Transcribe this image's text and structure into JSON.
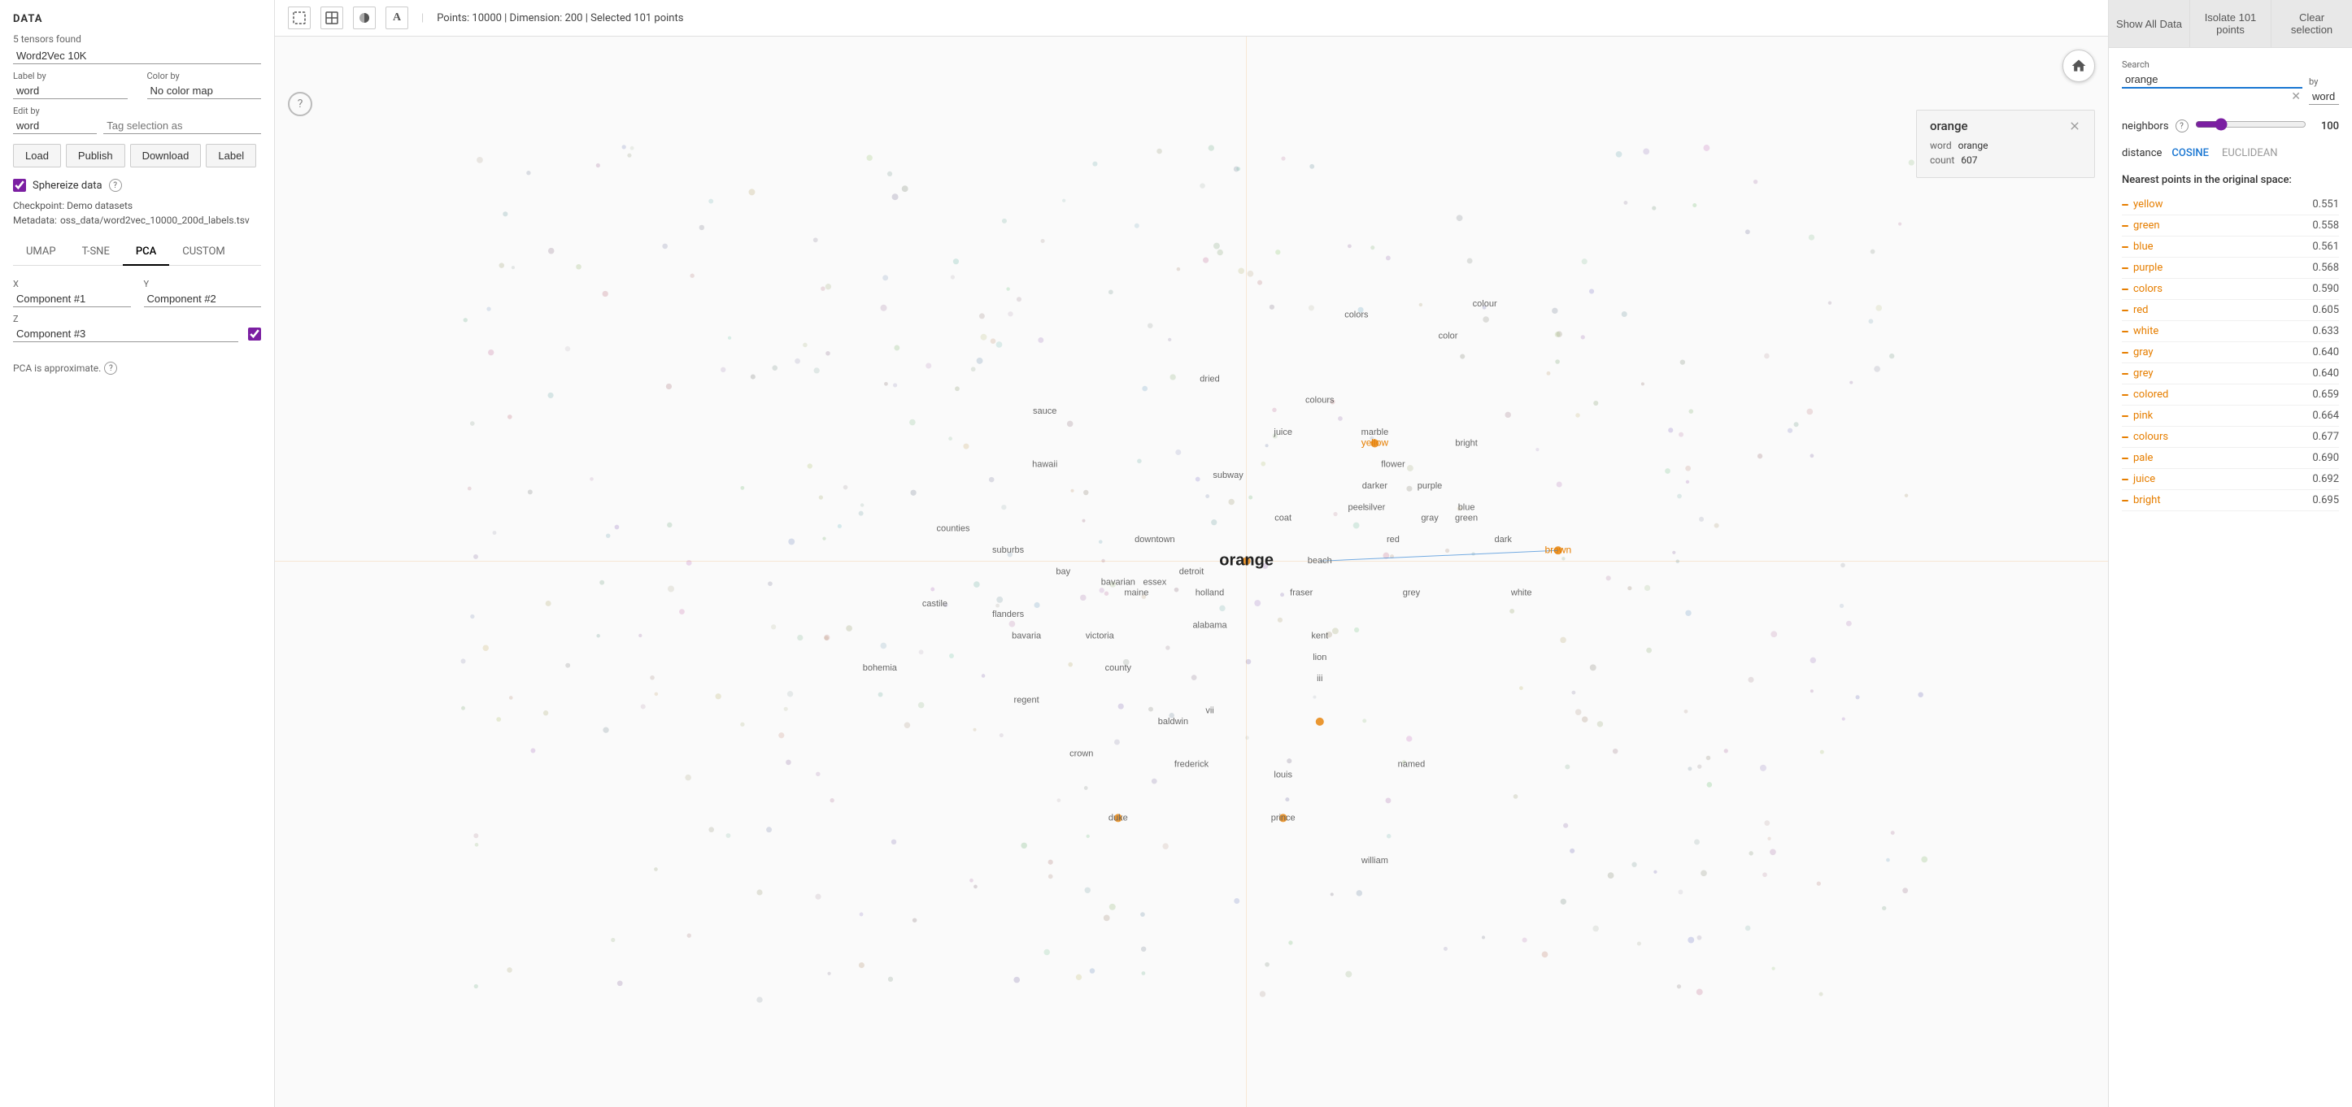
{
  "left_panel": {
    "title": "DATA",
    "tensor_count_label": "5 tensors found",
    "selected_tensor": "Word2Vec 10K",
    "label_by": {
      "label": "Label by",
      "value": "word"
    },
    "color_by": {
      "label": "Color by",
      "value": "No color map"
    },
    "edit_by": {
      "label": "Edit by",
      "value": "word"
    },
    "tag_selection_label": "Tag selection as",
    "buttons": {
      "load": "Load",
      "publish": "Publish",
      "download": "Download",
      "label": "Label"
    },
    "sphereize": {
      "label": "Sphereize data",
      "checked": true
    },
    "checkpoint": {
      "label": "Checkpoint:",
      "value": "Demo datasets"
    },
    "metadata": {
      "label": "Metadata:",
      "value": "oss_data/word2vec_10000_200d_labels.tsv"
    },
    "tabs": [
      "UMAP",
      "T-SNE",
      "PCA",
      "CUSTOM"
    ],
    "active_tab": "PCA",
    "axes": {
      "x_label": "X",
      "x_value": "Component #1",
      "y_label": "Y",
      "y_value": "Component #2",
      "z_label": "Z",
      "z_value": "Component #3",
      "z_checked": true
    },
    "pca_note": "PCA is approximate."
  },
  "toolbar": {
    "stats": "Points: 10000 | Dimension: 200 | Selected 101 points"
  },
  "right_panel": {
    "buttons": {
      "show_all": "Show All Data",
      "isolate": "Isolate 101 points",
      "clear": "Clear selection"
    },
    "search_label": "Search",
    "search_value": "orange",
    "by_label": "by",
    "by_value": "word",
    "neighbors_label": "neighbors",
    "neighbors_value": 100,
    "distance_label": "distance",
    "distance_options": [
      "COSINE",
      "EUCLIDEAN"
    ],
    "active_distance": "COSINE",
    "nearest_title": "Nearest points in the original space:",
    "nearest_items": [
      {
        "word": "yellow",
        "score": "0.551"
      },
      {
        "word": "green",
        "score": "0.558"
      },
      {
        "word": "blue",
        "score": "0.561"
      },
      {
        "word": "purple",
        "score": "0.568"
      },
      {
        "word": "colors",
        "score": "0.590"
      },
      {
        "word": "red",
        "score": "0.605"
      },
      {
        "word": "white",
        "score": "0.633"
      },
      {
        "word": "gray",
        "score": "0.640"
      },
      {
        "word": "grey",
        "score": "0.640"
      },
      {
        "word": "colored",
        "score": "0.659"
      },
      {
        "word": "pink",
        "score": "0.664"
      },
      {
        "word": "colours",
        "score": "0.677"
      },
      {
        "word": "pale",
        "score": "0.690"
      },
      {
        "word": "juice",
        "score": "0.692"
      },
      {
        "word": "bright",
        "score": "0.695"
      }
    ]
  },
  "hover_popup": {
    "word_label": "word",
    "word_value": "orange",
    "count_label": "count",
    "count_value": "607"
  },
  "scatter_words": [
    {
      "text": "colors",
      "x": 59,
      "y": 26,
      "type": "normal"
    },
    {
      "text": "colour",
      "x": 66,
      "y": 25,
      "type": "normal"
    },
    {
      "text": "color",
      "x": 64,
      "y": 28,
      "type": "normal"
    },
    {
      "text": "dried",
      "x": 51,
      "y": 32,
      "type": "normal"
    },
    {
      "text": "sauce",
      "x": 42,
      "y": 35,
      "type": "normal"
    },
    {
      "text": "juice",
      "x": 55,
      "y": 37,
      "type": "normal"
    },
    {
      "text": "marble",
      "x": 60,
      "y": 37,
      "type": "normal"
    },
    {
      "text": "colours",
      "x": 57,
      "y": 34,
      "type": "normal"
    },
    {
      "text": "yellow",
      "x": 60,
      "y": 38,
      "type": "orange"
    },
    {
      "text": "hawaii",
      "x": 42,
      "y": 40,
      "type": "normal"
    },
    {
      "text": "flower",
      "x": 61,
      "y": 40,
      "type": "normal"
    },
    {
      "text": "darker",
      "x": 60,
      "y": 42,
      "type": "normal"
    },
    {
      "text": "bright",
      "x": 65,
      "y": 38,
      "type": "normal"
    },
    {
      "text": "purple",
      "x": 63,
      "y": 42,
      "type": "normal"
    },
    {
      "text": "subway",
      "x": 52,
      "y": 41,
      "type": "normal"
    },
    {
      "text": "blue",
      "x": 65,
      "y": 44,
      "type": "normal"
    },
    {
      "text": "silver",
      "x": 60,
      "y": 44,
      "type": "normal"
    },
    {
      "text": "gray",
      "x": 63,
      "y": 45,
      "type": "normal"
    },
    {
      "text": "coat",
      "x": 55,
      "y": 45,
      "type": "normal"
    },
    {
      "text": "peel",
      "x": 59,
      "y": 44,
      "type": "normal"
    },
    {
      "text": "green",
      "x": 65,
      "y": 45,
      "type": "normal"
    },
    {
      "text": "counties",
      "x": 37,
      "y": 46,
      "type": "normal"
    },
    {
      "text": "suburbs",
      "x": 40,
      "y": 48,
      "type": "normal"
    },
    {
      "text": "downtown",
      "x": 48,
      "y": 47,
      "type": "normal"
    },
    {
      "text": "beach",
      "x": 57,
      "y": 49,
      "type": "normal"
    },
    {
      "text": "red",
      "x": 61,
      "y": 47,
      "type": "normal"
    },
    {
      "text": "dark",
      "x": 67,
      "y": 47,
      "type": "normal"
    },
    {
      "text": "orange",
      "x": 53,
      "y": 49,
      "type": "large-orange"
    },
    {
      "text": "brown",
      "x": 70,
      "y": 48,
      "type": "orange"
    },
    {
      "text": "bay",
      "x": 43,
      "y": 50,
      "type": "normal"
    },
    {
      "text": "detroit",
      "x": 50,
      "y": 50,
      "type": "normal"
    },
    {
      "text": "essex",
      "x": 48,
      "y": 51,
      "type": "normal"
    },
    {
      "text": "bavarian",
      "x": 46,
      "y": 51,
      "type": "normal"
    },
    {
      "text": "maine",
      "x": 47,
      "y": 52,
      "type": "normal"
    },
    {
      "text": "holland",
      "x": 51,
      "y": 52,
      "type": "normal"
    },
    {
      "text": "fraser",
      "x": 56,
      "y": 52,
      "type": "normal"
    },
    {
      "text": "castile",
      "x": 36,
      "y": 53,
      "type": "normal"
    },
    {
      "text": "flanders",
      "x": 40,
      "y": 54,
      "type": "normal"
    },
    {
      "text": "grey",
      "x": 62,
      "y": 52,
      "type": "normal"
    },
    {
      "text": "white",
      "x": 68,
      "y": 52,
      "type": "normal"
    },
    {
      "text": "bavaria",
      "x": 41,
      "y": 56,
      "type": "normal"
    },
    {
      "text": "alabama",
      "x": 51,
      "y": 55,
      "type": "normal"
    },
    {
      "text": "victoria",
      "x": 45,
      "y": 56,
      "type": "normal"
    },
    {
      "text": "kent",
      "x": 57,
      "y": 56,
      "type": "normal"
    },
    {
      "text": "lion",
      "x": 57,
      "y": 58,
      "type": "normal"
    },
    {
      "text": "bohemia",
      "x": 33,
      "y": 59,
      "type": "normal"
    },
    {
      "text": "county",
      "x": 46,
      "y": 59,
      "type": "normal"
    },
    {
      "text": "iii",
      "x": 57,
      "y": 60,
      "type": "normal"
    },
    {
      "text": "regent",
      "x": 41,
      "y": 62,
      "type": "normal"
    },
    {
      "text": "baldwin",
      "x": 49,
      "y": 64,
      "type": "normal"
    },
    {
      "text": "vii",
      "x": 51,
      "y": 63,
      "type": "normal"
    },
    {
      "text": "crown",
      "x": 44,
      "y": 67,
      "type": "normal"
    },
    {
      "text": "frederick",
      "x": 50,
      "y": 68,
      "type": "normal"
    },
    {
      "text": "louis",
      "x": 55,
      "y": 69,
      "type": "normal"
    },
    {
      "text": "named",
      "x": 62,
      "y": 68,
      "type": "normal"
    },
    {
      "text": "duke",
      "x": 46,
      "y": 73,
      "type": "normal"
    },
    {
      "text": "prince",
      "x": 55,
      "y": 73,
      "type": "normal"
    },
    {
      "text": "william",
      "x": 60,
      "y": 77,
      "type": "normal"
    }
  ]
}
